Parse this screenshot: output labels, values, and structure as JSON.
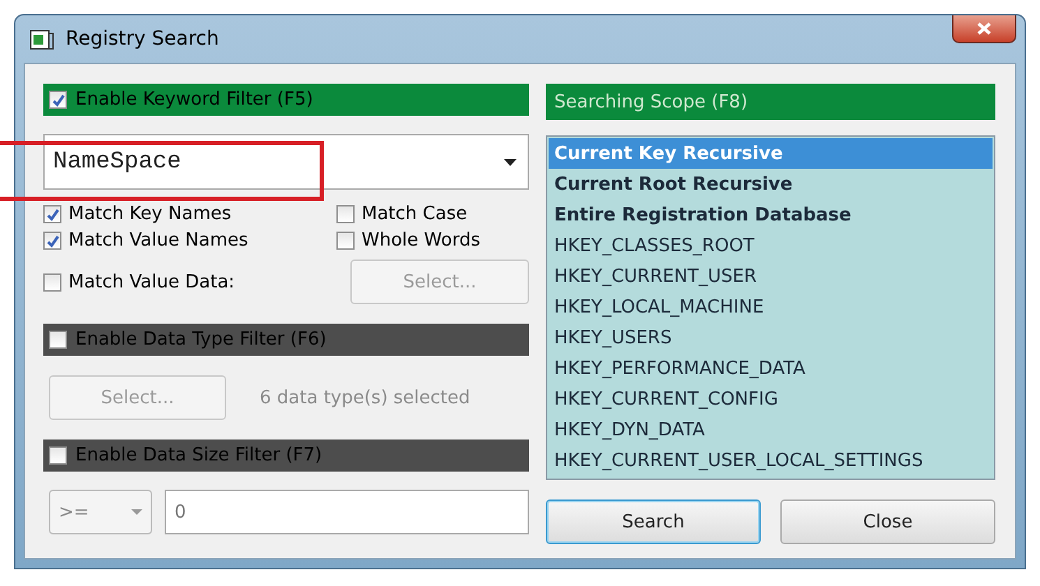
{
  "window": {
    "title": "Registry Search"
  },
  "keyword_filter": {
    "label": "Enable Keyword Filter (F5)",
    "checked": true,
    "value": "NameSpace",
    "options": [
      {
        "label": "Match Key Names",
        "checked": true
      },
      {
        "label": "Match Case",
        "checked": false
      },
      {
        "label": "Match Value Names",
        "checked": true
      },
      {
        "label": "Whole Words",
        "checked": false
      }
    ],
    "match_value_data": {
      "label": "Match Value Data:",
      "checked": false
    },
    "select_button": {
      "label": "Select...",
      "disabled": true
    }
  },
  "data_type_filter": {
    "label": "Enable Data Type Filter (F6)",
    "checked": false,
    "select_button": {
      "label": "Select...",
      "disabled": true
    },
    "summary": "6 data type(s) selected"
  },
  "data_size_filter": {
    "label": "Enable Data Size Filter (F7)",
    "checked": false,
    "operator": ">=",
    "value": "0"
  },
  "scope": {
    "label": "Searching Scope (F8)",
    "items": [
      {
        "label": "Current Key Recursive",
        "kind": "special",
        "selected": true
      },
      {
        "label": "Current Root Recursive",
        "kind": "special",
        "selected": false
      },
      {
        "label": "Entire Registration Database",
        "kind": "special",
        "selected": false
      },
      {
        "label": "HKEY_CLASSES_ROOT",
        "kind": "hive",
        "selected": false
      },
      {
        "label": "HKEY_CURRENT_USER",
        "kind": "hive",
        "selected": false
      },
      {
        "label": "HKEY_LOCAL_MACHINE",
        "kind": "hive",
        "selected": false
      },
      {
        "label": "HKEY_USERS",
        "kind": "hive",
        "selected": false
      },
      {
        "label": "HKEY_PERFORMANCE_DATA",
        "kind": "hive",
        "selected": false
      },
      {
        "label": "HKEY_CURRENT_CONFIG",
        "kind": "hive",
        "selected": false
      },
      {
        "label": "HKEY_DYN_DATA",
        "kind": "hive",
        "selected": false
      },
      {
        "label": "HKEY_CURRENT_USER_LOCAL_SETTINGS",
        "kind": "hive",
        "selected": false
      }
    ]
  },
  "buttons": [
    {
      "label": "Search",
      "default": true
    },
    {
      "label": "Close",
      "default": false
    }
  ]
}
